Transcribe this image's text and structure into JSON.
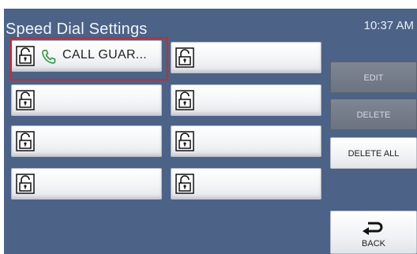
{
  "header": {
    "title": "Speed Dial Settings",
    "time": "10:37 AM"
  },
  "speed_dial": {
    "slots": [
      {
        "label": "CALL GUAR...",
        "icon": "phone-icon",
        "locked": true,
        "highlighted": true
      },
      {
        "label": "",
        "locked": true
      },
      {
        "label": "",
        "locked": true
      },
      {
        "label": "",
        "locked": true
      },
      {
        "label": "",
        "locked": true
      },
      {
        "label": "",
        "locked": true
      },
      {
        "label": "",
        "locked": true
      },
      {
        "label": "",
        "locked": true
      }
    ]
  },
  "actions": {
    "edit_label": "EDIT",
    "delete_label": "DELETE",
    "delete_all_label": "DELETE ALL",
    "back_label": "BACK"
  },
  "colors": {
    "background": "#4c6286",
    "highlight": "#d62626",
    "phone_icon": "#3a9a4a",
    "disabled_button": "#737a88"
  }
}
